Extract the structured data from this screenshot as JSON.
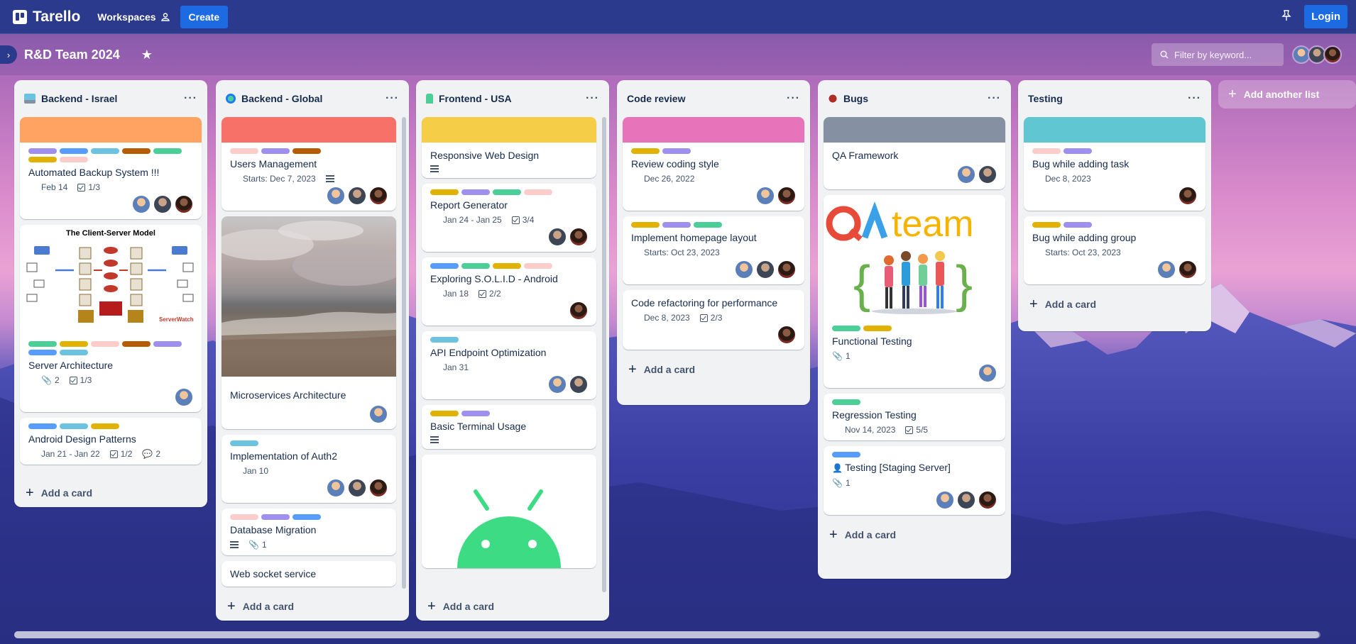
{
  "app": {
    "name": "Tarello",
    "workspaces": "Workspaces",
    "create": "Create",
    "login": "Login"
  },
  "board": {
    "title": "R&D Team 2024",
    "filter_placeholder": "Filter by keyword...",
    "add_list": "Add another list",
    "add_card": "Add a card"
  },
  "colors": {
    "green": "#4bce97",
    "yellow": "#e2b203",
    "orange": "#c25100",
    "red": "#f87168",
    "purple": "#9f8fef",
    "blue": "#579dff",
    "sky": "#6cc3e0",
    "pink": "#fdd0ec",
    "peach": "#fecdca",
    "darkorange": "#b65c02"
  },
  "lists": [
    {
      "title": "Backend - Israel",
      "cards": [
        {
          "cover": "#fea362",
          "labels": [
            "#9f8fef",
            "#579dff",
            "#6cc3e0",
            "#b65c02",
            "#4bce97",
            "#e2b203",
            "#fecdca"
          ],
          "title": "Automated Backup System !!!",
          "due": "Feb 14",
          "checklist": "1/3",
          "members": [
            "av1",
            "av2",
            "av3"
          ]
        },
        {
          "image": "client-server",
          "image_title": "The Client-Server Model",
          "labels": [
            "#4bce97",
            "#e2b203",
            "#fecdca",
            "#b65c02",
            "#9f8fef",
            "#579dff",
            "#6cc3e0"
          ],
          "title": "Server Architecture",
          "attachments": "2",
          "checklist": "1/3",
          "members": [
            "av1"
          ]
        },
        {
          "labels": [
            "#579dff",
            "#6cc3e0",
            "#e2b203"
          ],
          "title": "Android Design Patterns",
          "due": "Jan 21 - Jan 22",
          "checklist": "1/2",
          "comments": "2"
        }
      ]
    },
    {
      "title": "Backend - Global",
      "cards": [
        {
          "cover": "#f87168",
          "labels": [
            "#fecdca",
            "#9f8fef",
            "#b65c02"
          ],
          "title": "Users Management",
          "due": "Starts: Dec 7, 2023",
          "description": true,
          "members": [
            "av1",
            "av2",
            "av3"
          ]
        },
        {
          "image": "beach",
          "title": "Microservices Architecture",
          "members": [
            "av1"
          ]
        },
        {
          "labels": [
            "#6cc3e0"
          ],
          "title": "Implementation of Auth2",
          "due": "Jan 10",
          "members": [
            "av1",
            "av2",
            "av3"
          ]
        },
        {
          "labels": [
            "#fecdca",
            "#9f8fef",
            "#579dff"
          ],
          "title": "Database Migration",
          "description": true,
          "attachments": "1"
        },
        {
          "title": "Web socket service"
        }
      ]
    },
    {
      "title": "Frontend - USA",
      "cards": [
        {
          "cover": "#f5cd47",
          "title": "Responsive Web Design",
          "description": true
        },
        {
          "labels": [
            "#e2b203",
            "#9f8fef",
            "#4bce97",
            "#fecdca"
          ],
          "title": "Report Generator",
          "due": "Jan 24 - Jan 25",
          "checklist": "3/4",
          "members": [
            "av2",
            "av3"
          ]
        },
        {
          "labels": [
            "#579dff",
            "#4bce97",
            "#e2b203",
            "#fecdca"
          ],
          "title": "Exploring S.O.L.I.D - Android",
          "due": "Jan 18",
          "checklist": "2/2",
          "members": [
            "av3"
          ]
        },
        {
          "labels": [
            "#6cc3e0"
          ],
          "title": "API Endpoint Optimization",
          "due": "Jan 31",
          "members": [
            "av1",
            "av2"
          ]
        },
        {
          "labels": [
            "#e2b203",
            "#9f8fef"
          ],
          "title": "Basic Terminal Usage",
          "description": true
        },
        {
          "image": "android"
        }
      ]
    },
    {
      "title": "Code review",
      "cards": [
        {
          "cover": "#e774bb",
          "labels": [
            "#e2b203",
            "#9f8fef"
          ],
          "title": "Review coding style",
          "due": "Dec 26, 2022",
          "members": [
            "av1",
            "av3"
          ]
        },
        {
          "labels": [
            "#e2b203",
            "#9f8fef",
            "#4bce97"
          ],
          "title": "Implement homepage layout",
          "due": "Starts: Oct 23, 2023",
          "members": [
            "av1",
            "av2",
            "av3"
          ]
        },
        {
          "title": "Code refactoring for performance",
          "due": "Dec 8, 2023",
          "checklist": "2/3",
          "members": [
            "av3"
          ]
        }
      ]
    },
    {
      "title": "Bugs",
      "cards": [
        {
          "cover": "#8590a2",
          "title": "QA Framework",
          "members": [
            "av1",
            "av2"
          ]
        },
        {
          "image": "qa",
          "image_title_a": "QA",
          "image_title_b": "team",
          "labels": [
            "#4bce97",
            "#e2b203"
          ],
          "title": "Functional Testing",
          "attachments": "1",
          "members": [
            "av1"
          ]
        },
        {
          "labels": [
            "#4bce97"
          ],
          "title": "Regression Testing",
          "due": "Nov 14, 2023",
          "checklist": "5/5"
        },
        {
          "labels": [
            "#579dff"
          ],
          "title": "Testing [Staging Server]",
          "attachments": "1",
          "members": [
            "av1",
            "av2",
            "av3"
          ]
        }
      ]
    },
    {
      "title": "Testing",
      "cards": [
        {
          "cover": "#60c6d2",
          "labels": [
            "#fecdca",
            "#9f8fef"
          ],
          "title": "Bug while adding task",
          "due": "Dec 8, 2023",
          "members": [
            "av3"
          ]
        },
        {
          "labels": [
            "#e2b203",
            "#9f8fef"
          ],
          "title": "Bug while adding group",
          "due": "Starts: Oct 23, 2023",
          "members": [
            "av1",
            "av3"
          ]
        }
      ]
    }
  ]
}
